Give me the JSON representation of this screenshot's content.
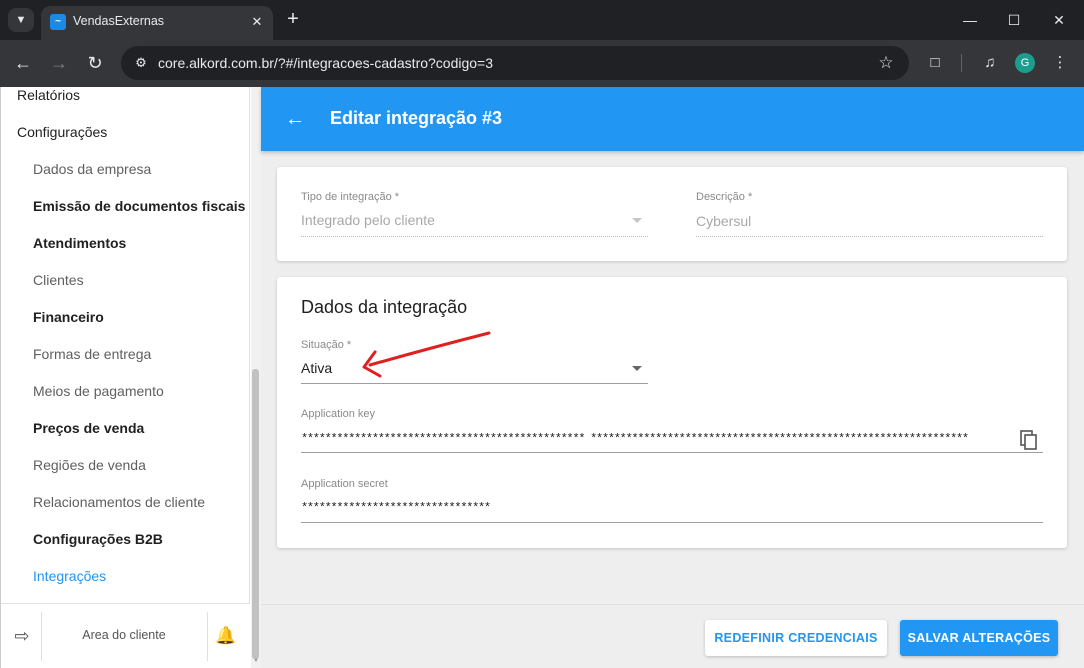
{
  "browser": {
    "tab_title": "VendasExternas",
    "url": "core.alkord.com.br/?#/integracoes-cadastro?codigo=3",
    "profile_initial": "G"
  },
  "sidebar": {
    "items": [
      {
        "label": "Relatórios"
      },
      {
        "label": "Configurações"
      },
      {
        "label": "Dados da empresa"
      },
      {
        "label": "Emissão de documentos fiscais"
      },
      {
        "label": "Atendimentos"
      },
      {
        "label": "Clientes"
      },
      {
        "label": "Financeiro"
      },
      {
        "label": "Formas de entrega"
      },
      {
        "label": "Meios de pagamento"
      },
      {
        "label": "Preços de venda"
      },
      {
        "label": "Regiões de venda"
      },
      {
        "label": "Relacionamentos de cliente"
      },
      {
        "label": "Configurações B2B"
      },
      {
        "label": "Integrações"
      }
    ],
    "footer": {
      "client_area": "Area do cliente"
    }
  },
  "header": {
    "title": "Editar integração #3"
  },
  "general": {
    "type_label": "Tipo de integração *",
    "type_value": "Integrado pelo cliente",
    "description_label": "Descrição *",
    "description_value": "Cybersul"
  },
  "integration": {
    "title": "Dados da integração",
    "status_label": "Situação *",
    "status_value": "Ativa",
    "app_key_label": "Application key",
    "app_key_value": "************************************************ ****************************************************************",
    "app_secret_label": "Application secret",
    "app_secret_value": "********************************"
  },
  "actions": {
    "reset_label": "REDEFINIR CREDENCIAIS",
    "save_label": "SALVAR ALTERAÇÕES"
  },
  "colors": {
    "primary": "#2196f3",
    "annotation_arrow": "#e02020"
  }
}
